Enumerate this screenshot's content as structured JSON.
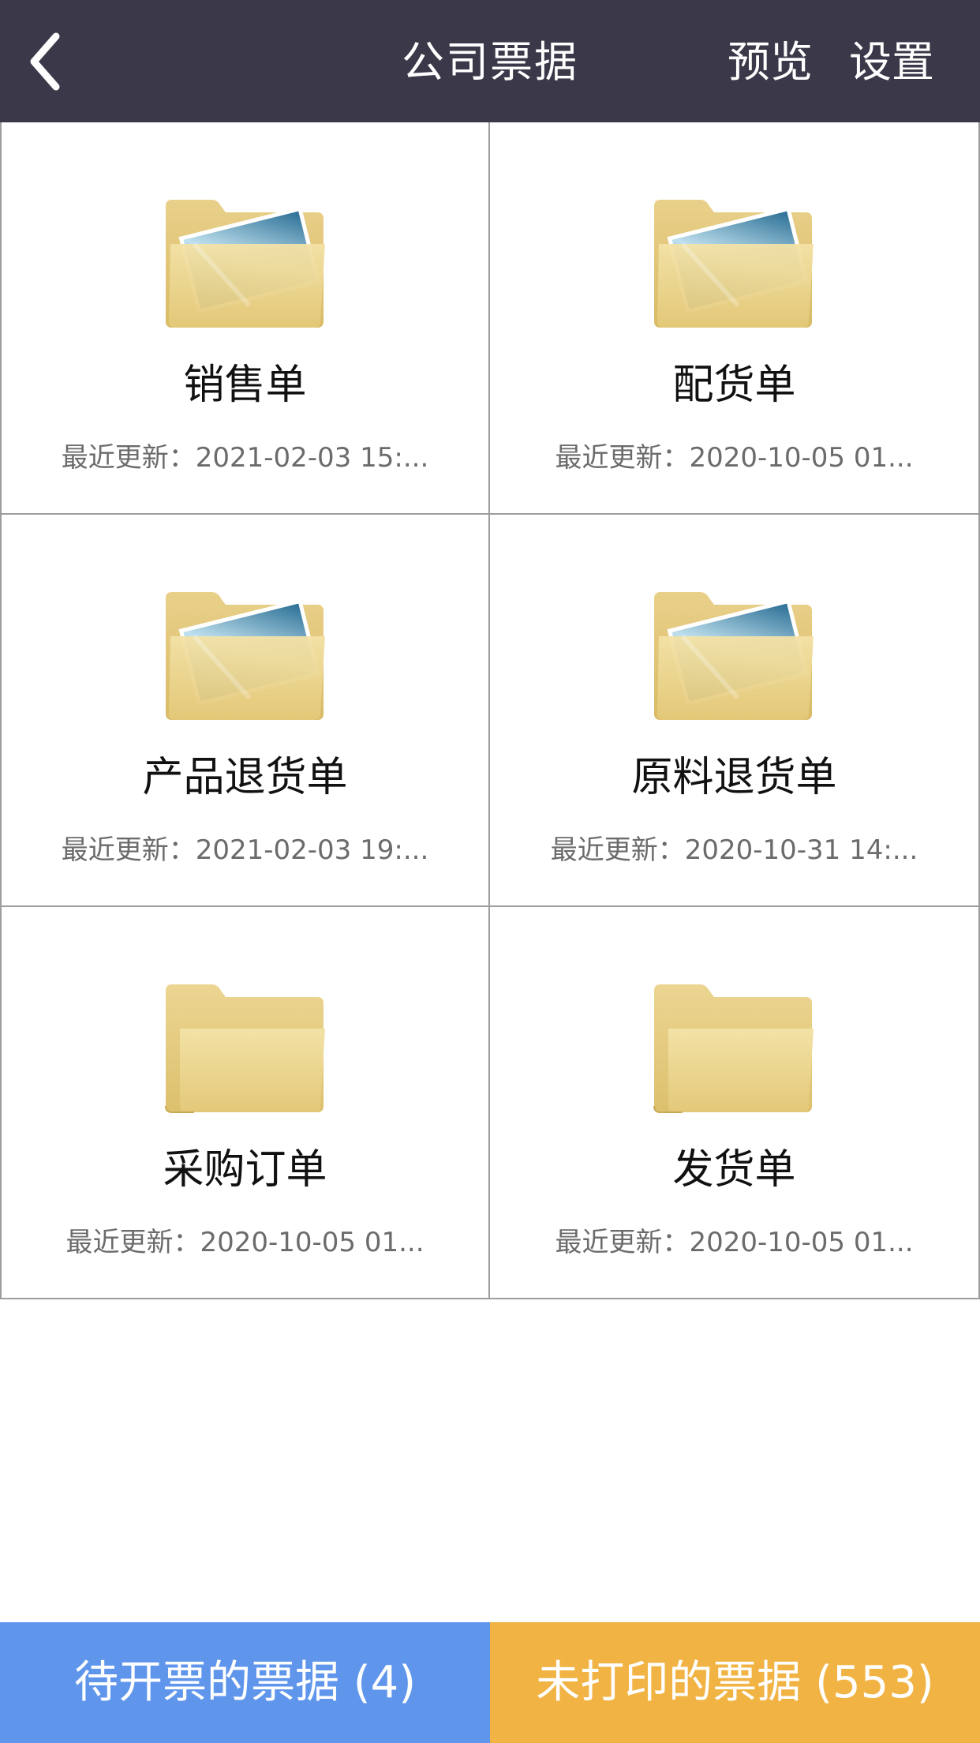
{
  "header": {
    "title": "公司票据",
    "preview_label": "预览",
    "settings_label": "设置"
  },
  "folders": [
    {
      "name": "销售单",
      "updated": "最近更新：2021-02-03 15:...",
      "icon": "folder-with-photo-icon"
    },
    {
      "name": "配货单",
      "updated": "最近更新：2020-10-05 01...",
      "icon": "folder-with-photo-icon"
    },
    {
      "name": "产品退货单",
      "updated": "最近更新：2021-02-03 19:...",
      "icon": "folder-with-photo-icon"
    },
    {
      "name": "原料退货单",
      "updated": "最近更新：2020-10-31 14:...",
      "icon": "folder-with-photo-icon"
    },
    {
      "name": "采购订单",
      "updated": "最近更新：2020-10-05 01...",
      "icon": "folder-icon"
    },
    {
      "name": "发货单",
      "updated": "最近更新：2020-10-05 01...",
      "icon": "folder-icon"
    }
  ],
  "bottom": {
    "pending_label": "待开票的票据 (4)",
    "unprinted_label": "未打印的票据 (553)"
  },
  "colors": {
    "header_bg": "#3b3949",
    "pending_bg": "#5f96ec",
    "unprinted_bg": "#f1b343"
  }
}
